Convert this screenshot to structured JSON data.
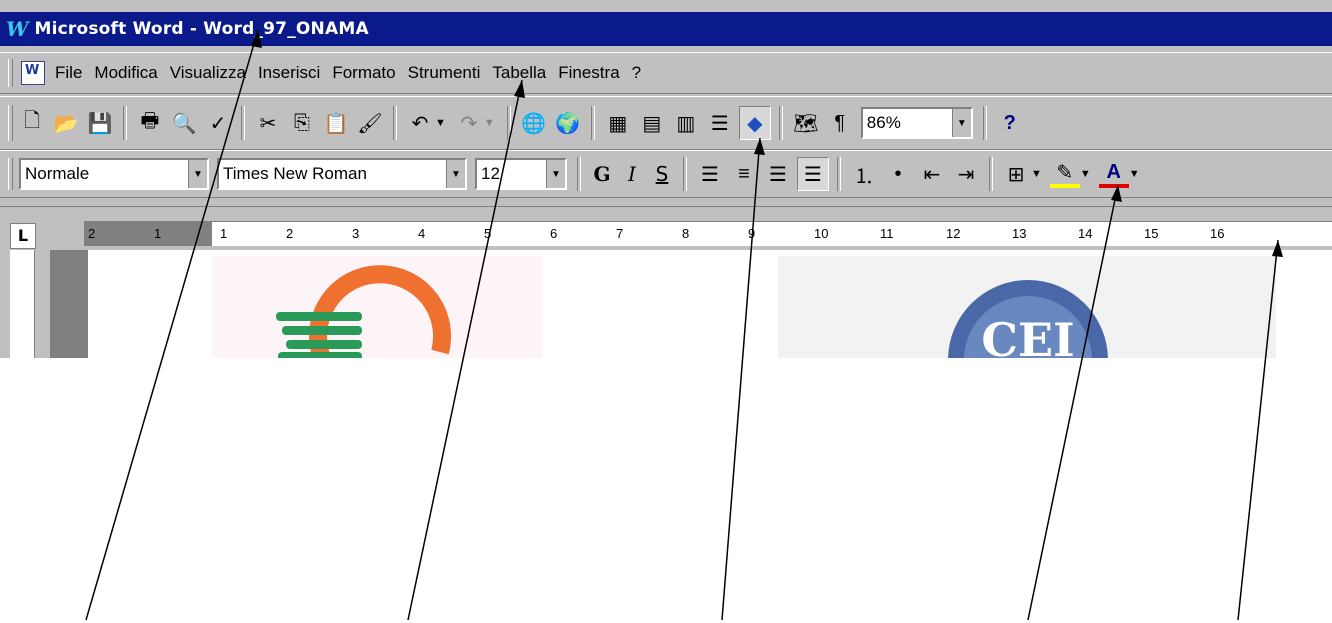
{
  "window": {
    "title": "Microsoft Word - Word_97_ONAMA",
    "app_icon_letter": "W"
  },
  "menubar": {
    "items": [
      "File",
      "Modifica",
      "Visualizza",
      "Inserisci",
      "Formato",
      "Strumenti",
      "Tabella",
      "Finestra",
      "?"
    ]
  },
  "standard_toolbar": {
    "buttons": [
      {
        "name": "new-document",
        "glyph": "🗋"
      },
      {
        "name": "open",
        "glyph": "📂"
      },
      {
        "name": "save",
        "glyph": "💾"
      },
      {
        "name": "print",
        "glyph": "🖶"
      },
      {
        "name": "print-preview",
        "glyph": "🔍"
      },
      {
        "name": "spelling",
        "glyph": "✓"
      },
      {
        "name": "cut",
        "glyph": "✂"
      },
      {
        "name": "copy",
        "glyph": "⎘"
      },
      {
        "name": "paste",
        "glyph": "📋"
      },
      {
        "name": "format-painter",
        "glyph": "🖌"
      },
      {
        "name": "undo",
        "glyph": "↶"
      },
      {
        "name": "redo",
        "glyph": "↷"
      },
      {
        "name": "hyperlink",
        "glyph": "🌐"
      },
      {
        "name": "web-toolbar",
        "glyph": "🌍"
      },
      {
        "name": "tables-borders",
        "glyph": "▦"
      },
      {
        "name": "insert-table",
        "glyph": "▤"
      },
      {
        "name": "insert-excel",
        "glyph": "▥"
      },
      {
        "name": "columns",
        "glyph": "☰"
      },
      {
        "name": "drawing",
        "glyph": "◆"
      },
      {
        "name": "document-map",
        "glyph": "🗺"
      },
      {
        "name": "show-hide",
        "glyph": "¶"
      },
      {
        "name": "help",
        "glyph": "?"
      }
    ],
    "zoom": "86%"
  },
  "formatting_toolbar": {
    "style": "Normale",
    "font": "Times New Roman",
    "size": "12",
    "bold": "G",
    "italic": "I",
    "underline": "S"
  },
  "ruler": {
    "tab_selector": "L",
    "numbers": [
      "2",
      "1",
      "1",
      "2",
      "3",
      "4",
      "5",
      "6",
      "7",
      "8",
      "9",
      "10",
      "11",
      "12",
      "13",
      "14",
      "15",
      "16"
    ]
  },
  "logo_right_text": "CEI"
}
